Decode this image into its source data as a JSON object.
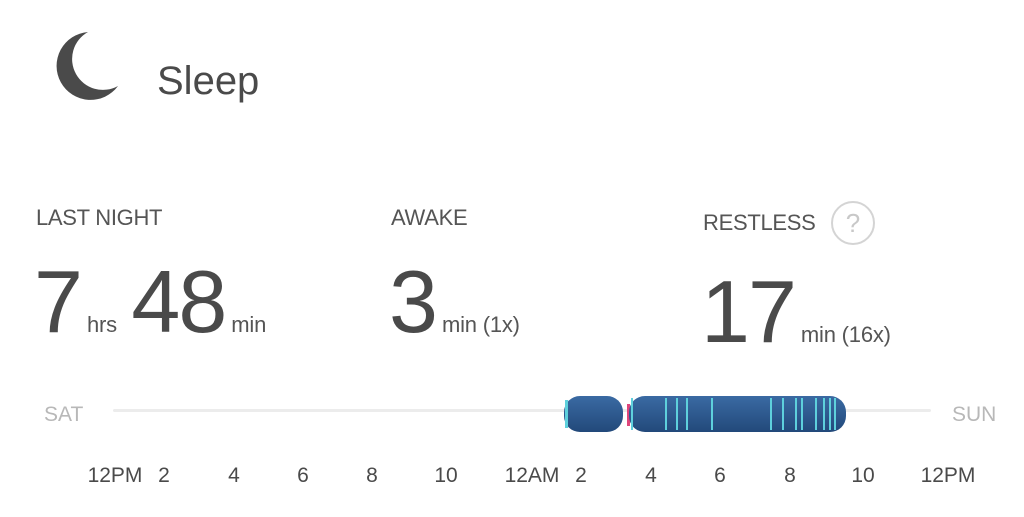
{
  "header": {
    "title": "Sleep",
    "icon": "moon-icon"
  },
  "stats": {
    "last_night": {
      "label": "LAST NIGHT",
      "hours": "7",
      "hours_unit": "hrs",
      "minutes": "48",
      "minutes_unit": "min"
    },
    "awake": {
      "label": "AWAKE",
      "value": "3",
      "unit": "min (1x)"
    },
    "restless": {
      "label": "RESTLESS",
      "value": "17",
      "unit": "min (16x)",
      "help": "?"
    }
  },
  "timeline": {
    "start_day": "SAT",
    "end_day": "SUN",
    "ticks": [
      "12PM",
      "2",
      "4",
      "6",
      "8",
      "10",
      "12AM",
      "2",
      "4",
      "6",
      "8",
      "10",
      "12PM"
    ],
    "colors": {
      "asleep": "#2c5a8f",
      "restless": "#5ed0dc",
      "awake": "#e0457b",
      "track": "#ececec"
    }
  }
}
